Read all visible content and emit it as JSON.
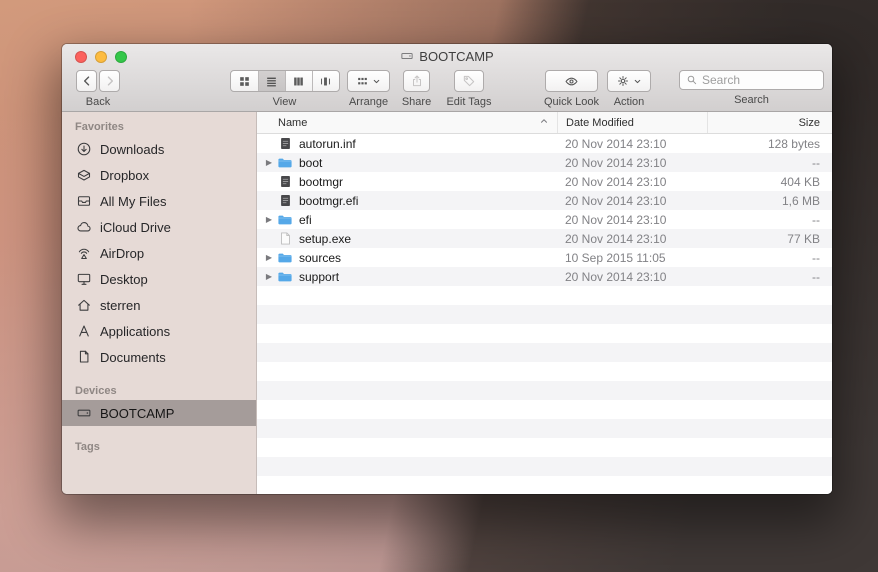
{
  "window": {
    "title": "BOOTCAMP"
  },
  "toolbar": {
    "back_label": "Back",
    "view_label": "View",
    "arrange_label": "Arrange",
    "share_label": "Share",
    "edit_tags_label": "Edit Tags",
    "quick_look_label": "Quick Look",
    "action_label": "Action",
    "search_label": "Search",
    "search_placeholder": "Search",
    "view_selected": "list"
  },
  "sidebar": {
    "sections": [
      {
        "title": "Favorites",
        "items": [
          {
            "label": "Downloads",
            "icon": "downloads"
          },
          {
            "label": "Dropbox",
            "icon": "dropbox"
          },
          {
            "label": "All My Files",
            "icon": "all-my-files"
          },
          {
            "label": "iCloud Drive",
            "icon": "cloud"
          },
          {
            "label": "AirDrop",
            "icon": "airdrop"
          },
          {
            "label": "Desktop",
            "icon": "desktop"
          },
          {
            "label": "sterren",
            "icon": "home"
          },
          {
            "label": "Applications",
            "icon": "applications"
          },
          {
            "label": "Documents",
            "icon": "document"
          }
        ]
      },
      {
        "title": "Devices",
        "items": [
          {
            "label": "BOOTCAMP",
            "icon": "drive",
            "selected": true
          }
        ]
      },
      {
        "title": "Tags",
        "items": []
      }
    ]
  },
  "filelist": {
    "columns": [
      "Name",
      "Date Modified",
      "Size"
    ],
    "sort_column": "Name",
    "sort_direction": "ascending",
    "rows": [
      {
        "name": "autorun.inf",
        "date": "20 Nov 2014 23:10",
        "size": "128 bytes",
        "icon": "file-dark",
        "expandable": false
      },
      {
        "name": "boot",
        "date": "20 Nov 2014 23:10",
        "size": "--",
        "icon": "folder",
        "expandable": true
      },
      {
        "name": "bootmgr",
        "date": "20 Nov 2014 23:10",
        "size": "404 KB",
        "icon": "file-dark",
        "expandable": false
      },
      {
        "name": "bootmgr.efi",
        "date": "20 Nov 2014 23:10",
        "size": "1,6 MB",
        "icon": "file-dark",
        "expandable": false
      },
      {
        "name": "efi",
        "date": "20 Nov 2014 23:10",
        "size": "--",
        "icon": "folder",
        "expandable": true
      },
      {
        "name": "setup.exe",
        "date": "20 Nov 2014 23:10",
        "size": "77 KB",
        "icon": "file-light",
        "expandable": false
      },
      {
        "name": "sources",
        "date": "10 Sep 2015 11:05",
        "size": "--",
        "icon": "folder",
        "expandable": true
      },
      {
        "name": "support",
        "date": "20 Nov 2014 23:10",
        "size": "--",
        "icon": "folder",
        "expandable": true
      }
    ]
  },
  "colors": {
    "folder_blue": "#55a8e8",
    "sidebar_bg": "#e6dad6",
    "sidebar_selected": "#a59c9a",
    "row_stripe": "#f4f4f6",
    "traffic_red": "#fc615d",
    "traffic_yellow": "#fdbc40",
    "traffic_green": "#34c749"
  },
  "icons": [
    "close",
    "minimize",
    "zoom",
    "drive",
    "back-chevron",
    "forward-chevron",
    "icon-view",
    "list-view",
    "column-view",
    "coverflow-view",
    "arrange-grid",
    "chevron-down",
    "share",
    "tag",
    "eye",
    "gear",
    "magnifier",
    "disclosure-triangle",
    "folder",
    "file"
  ]
}
